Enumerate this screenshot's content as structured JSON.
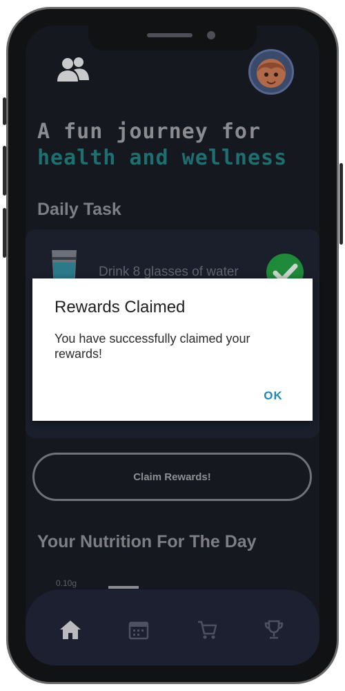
{
  "header": {
    "people_icon": "people-icon",
    "avatar": "user-avatar"
  },
  "hero": {
    "line1": "A fun journey for",
    "line2": "health and wellness"
  },
  "daily_task": {
    "title": "Daily Task",
    "items": [
      {
        "icon": "water-glass-icon",
        "label": "Drink 8 glasses of water",
        "completed": true
      }
    ],
    "claim_button": "Claim Rewards!"
  },
  "nutrition": {
    "title": "Your Nutrition For The Day",
    "chart_label": "0.10g"
  },
  "dialog": {
    "title": "Rewards Claimed",
    "message": "You have successfully claimed your rewards!",
    "ok_label": "OK"
  },
  "bottom_nav": {
    "items": [
      {
        "icon": "home-icon",
        "active": true
      },
      {
        "icon": "calendar-icon",
        "active": false
      },
      {
        "icon": "cart-icon",
        "active": false
      },
      {
        "icon": "trophy-icon",
        "active": false
      }
    ]
  },
  "colors": {
    "background": "#15181f",
    "accent_teal": "#1d6f70",
    "check_green": "#1f8a39",
    "ok_blue": "#1e88b8"
  }
}
